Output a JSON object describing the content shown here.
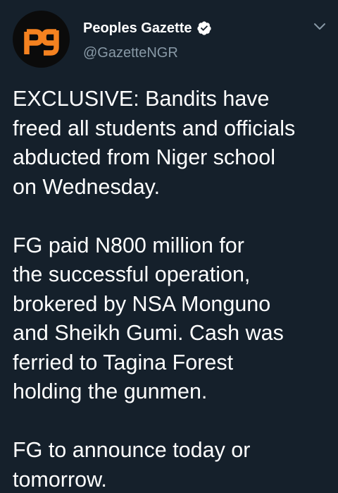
{
  "account": {
    "avatar_text": "pg",
    "avatar_color": "#f58220",
    "display_name": "Peoples Gazette",
    "handle": "@GazetteNGR",
    "verified": true
  },
  "tweet": {
    "paragraphs": [
      "EXCLUSIVE: Bandits have\nfreed all students and officials\nabducted from Niger school\non Wednesday.",
      "FG paid N800 million for\nthe successful operation,\nbrokered by NSA Monguno\nand Sheikh Gumi. Cash was\nferried to Tagina Forest\nholding the gunmen.",
      "FG to announce today or\ntomorrow."
    ]
  },
  "icons": {
    "verified": "verified-badge-icon",
    "menu": "chevron-down-icon"
  },
  "colors": {
    "background": "#15202b",
    "text": "#ffffff",
    "secondary_text": "#8899a6",
    "brand_orange": "#f58220"
  }
}
